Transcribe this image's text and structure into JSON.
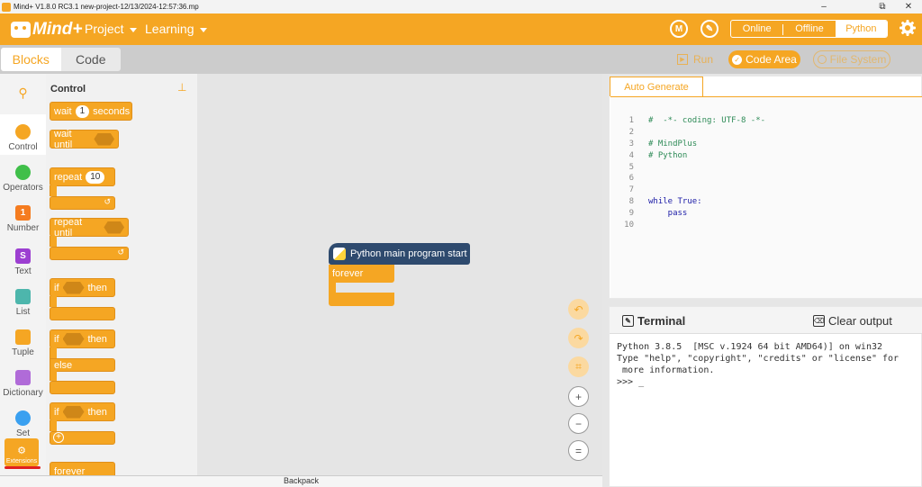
{
  "window": {
    "title": "Mind+ V1.8.0 RC3.1   new-project-12/13/2024-12:57:36.mp",
    "minimize": "–",
    "maximize": "⧉",
    "close": "✕"
  },
  "menubar": {
    "logo": "Mind+",
    "project": "Project",
    "learning": "Learning",
    "modes": {
      "online": "Online",
      "offline": "Offline",
      "python": "Python"
    },
    "active_mode": "Python",
    "accent": "#f5a623"
  },
  "toolbar": {
    "tabs": {
      "blocks": "Blocks",
      "code": "Code"
    },
    "run": "Run",
    "code_area": "Code Area",
    "file_system": "File System"
  },
  "categories": [
    {
      "label": "",
      "icon": "search-icon"
    },
    {
      "label": "Control",
      "color": "#f5a623",
      "selected": true
    },
    {
      "label": "Operators",
      "color": "#40bf4a"
    },
    {
      "label": "Number",
      "color": "#f57c20",
      "glyph": "1"
    },
    {
      "label": "Text",
      "color": "#9c3fd1",
      "glyph": "S"
    },
    {
      "label": "List",
      "color": "#4db6ac"
    },
    {
      "label": "Tuple",
      "color": "#f5a623"
    },
    {
      "label": "Dictionary",
      "color": "#b06bd8"
    },
    {
      "label": "Set",
      "color": "#3aa0f0"
    }
  ],
  "extensions_label": "Extensions",
  "flyout": {
    "title": "Control",
    "wait": "wait",
    "wait_value": "1",
    "seconds": "seconds",
    "wait_until": "wait until",
    "repeat": "repeat",
    "repeat_value": "10",
    "repeat_until": "repeat until",
    "if1": "if",
    "then1": "then",
    "if2": "if",
    "then2": "then",
    "else": "else",
    "if3": "if",
    "then3": "then",
    "forever": "forever",
    "loop_arrow": "↺"
  },
  "workspace": {
    "hat_label": "Python main program start",
    "forever_label": "forever"
  },
  "backpack": "Backpack",
  "code": {
    "tab": "Auto Generate",
    "lines": [
      {
        "n": "1",
        "t": "#  -*- coding: UTF-8 -*-",
        "c": "#2e8b57"
      },
      {
        "n": "2",
        "t": "",
        "c": "#333"
      },
      {
        "n": "3",
        "t": "# MindPlus",
        "c": "#2e8b57"
      },
      {
        "n": "4",
        "t": "# Python",
        "c": "#2e8b57"
      },
      {
        "n": "5",
        "t": "",
        "c": "#333"
      },
      {
        "n": "6",
        "t": "",
        "c": "#333"
      },
      {
        "n": "7",
        "t": "",
        "c": "#333"
      },
      {
        "n": "8",
        "t": "while True:",
        "c": "#1a1aa6"
      },
      {
        "n": "9",
        "t": "    pass",
        "c": "#1a1aa6"
      },
      {
        "n": "10",
        "t": "",
        "c": "#333"
      }
    ]
  },
  "terminal": {
    "title": "Terminal",
    "clear": "Clear output",
    "output": "Python 3.8.5  [MSC v.1924 64 bit AMD64)] on win32\nType \"help\", \"copyright\", \"credits\" or \"license\" for\n more information.\n>>> _"
  }
}
